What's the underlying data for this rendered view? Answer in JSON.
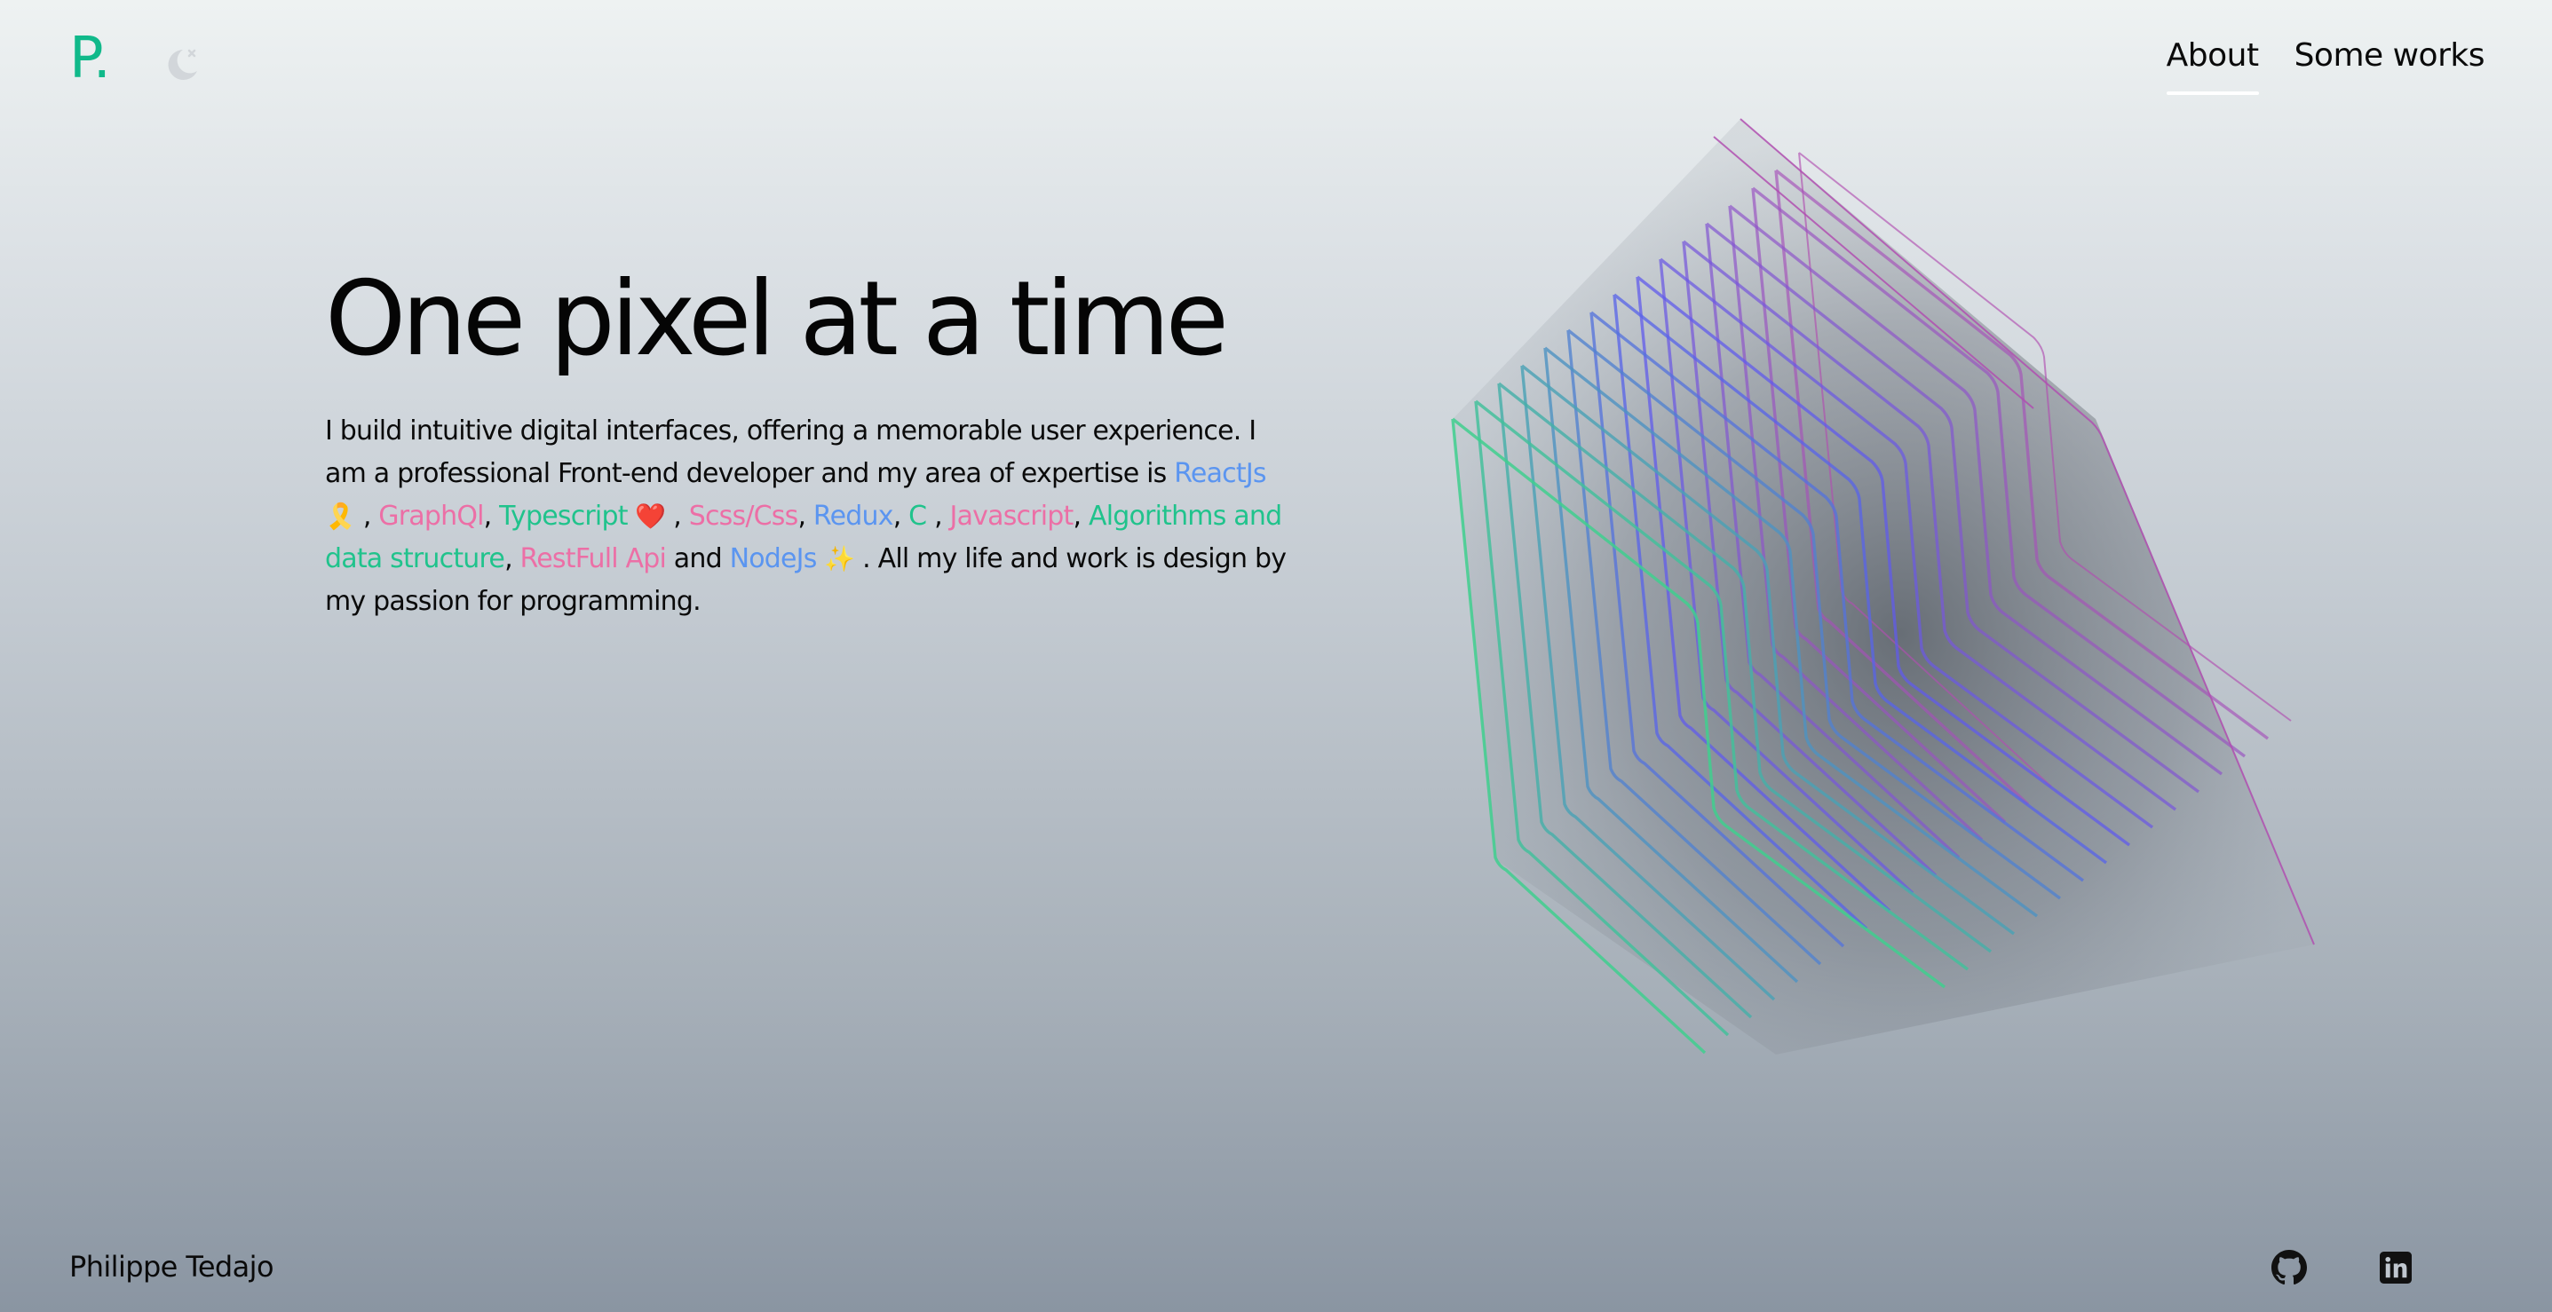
{
  "header": {
    "logo": "P.",
    "theme_toggle_icon": "moon-icon",
    "nav": [
      {
        "label": "About",
        "active": true
      },
      {
        "label": "Some works",
        "active": false
      }
    ]
  },
  "hero": {
    "title": "One pixel at a time",
    "intro": "I build intuitive digital interfaces, offering a memorable user experience. I am a professional Front-end developer and my area of expertise is",
    "skills": [
      {
        "name": "ReactJs",
        "emoji": "🎗️",
        "color": "#5b95f0"
      },
      {
        "name": "GraphQl",
        "color": "#ec6fa6"
      },
      {
        "name": "Typescript",
        "emoji": "❤️",
        "color": "#20c38c"
      },
      {
        "name": "Scss/Css",
        "color": "#ec6fa6"
      },
      {
        "name": "Redux",
        "color": "#5b95f0"
      },
      {
        "name": "C",
        "color": "#20c38c"
      },
      {
        "name": "Javascript",
        "color": "#ec6fa6"
      },
      {
        "name": "Algorithms and data structure",
        "color": "#20c38c"
      },
      {
        "name": "RestFull Api",
        "color": "#ec6fa6"
      },
      {
        "name": "NodeJs",
        "emoji": "✨",
        "color": "#5b95f0"
      }
    ],
    "connector_and": "and",
    "closing": ". All my life and work is design by my passion for programming."
  },
  "illustration": {
    "icon": "layered-cube-graphic",
    "colors": [
      "#3fcf8e",
      "#5a5cf0",
      "#b04fb0"
    ]
  },
  "footer": {
    "name": "Philippe Tedajo",
    "social": [
      {
        "icon": "github-icon"
      },
      {
        "icon": "linkedin-icon"
      }
    ]
  }
}
